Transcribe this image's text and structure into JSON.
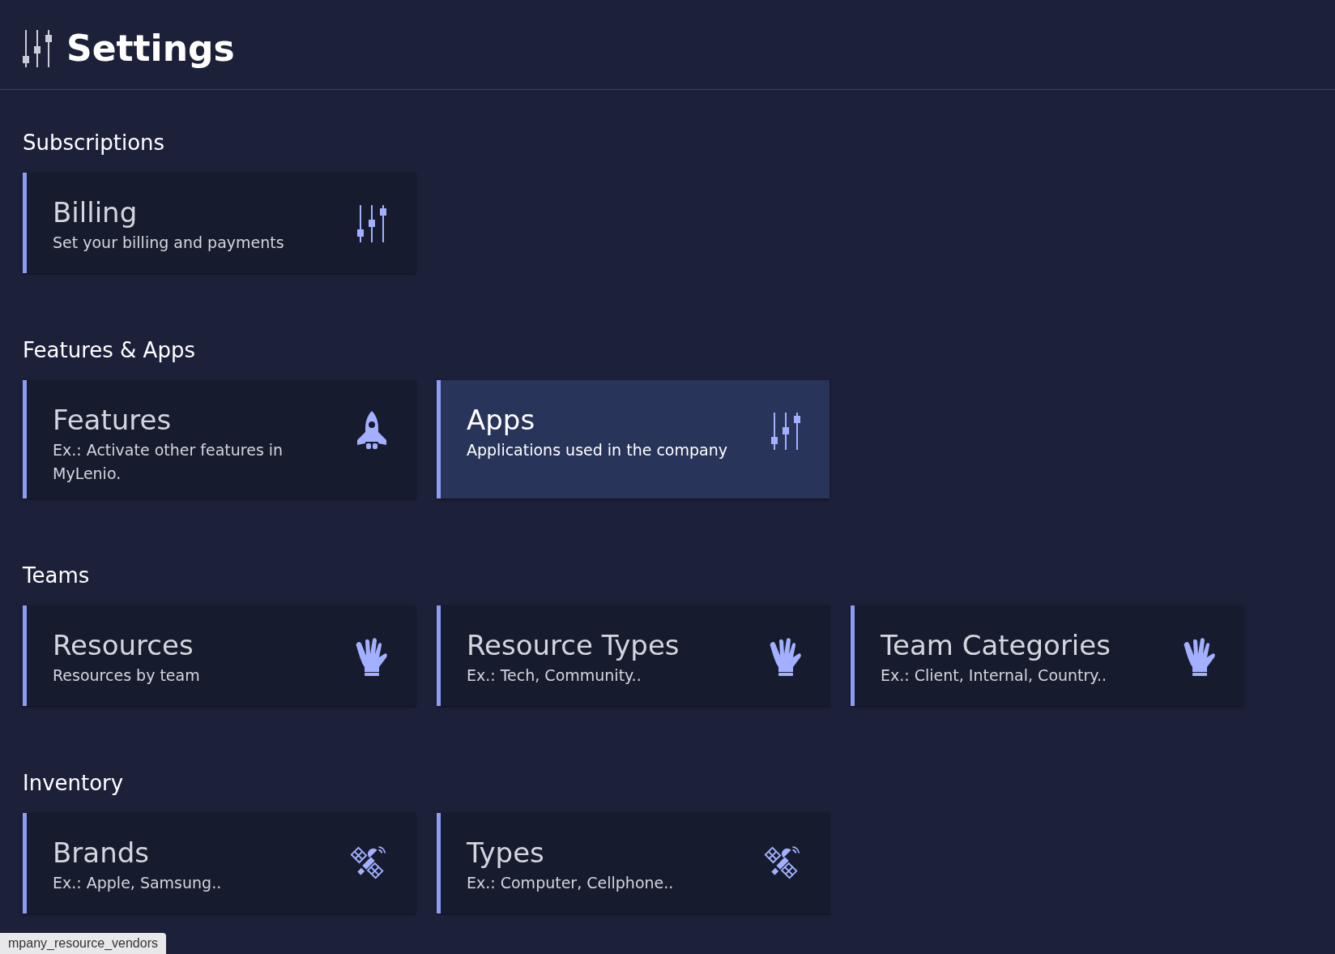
{
  "header": {
    "title": "Settings"
  },
  "sections": [
    {
      "title": "Subscriptions",
      "cards": [
        {
          "title": "Billing",
          "subtitle": "Set your billing and payments",
          "kind": "sliders",
          "selected": false
        }
      ]
    },
    {
      "title": "Features & Apps",
      "cards": [
        {
          "title": "Features",
          "subtitle": "Ex.: Activate other features in MyLenio.",
          "kind": "rocket",
          "selected": false
        },
        {
          "title": "Apps",
          "subtitle": "Applications used in the company",
          "kind": "sliders",
          "selected": true
        }
      ]
    },
    {
      "title": "Teams",
      "cards": [
        {
          "title": "Resources",
          "subtitle": "Resources by team",
          "kind": "hand",
          "selected": false
        },
        {
          "title": "Resource Types",
          "subtitle": "Ex.: Tech, Community..",
          "kind": "hand",
          "selected": false
        },
        {
          "title": "Team Categories",
          "subtitle": "Ex.: Client, Internal, Country..",
          "kind": "hand",
          "selected": false
        }
      ]
    },
    {
      "title": "Inventory",
      "cards": [
        {
          "title": "Brands",
          "subtitle": "Ex.: Apple, Samsung..",
          "kind": "satellite",
          "selected": false
        },
        {
          "title": "Types",
          "subtitle": "Ex.: Computer, Cellphone..",
          "kind": "satellite",
          "selected": false
        }
      ]
    }
  ],
  "status_bar": {
    "url": "mpany_resource_vendors"
  }
}
